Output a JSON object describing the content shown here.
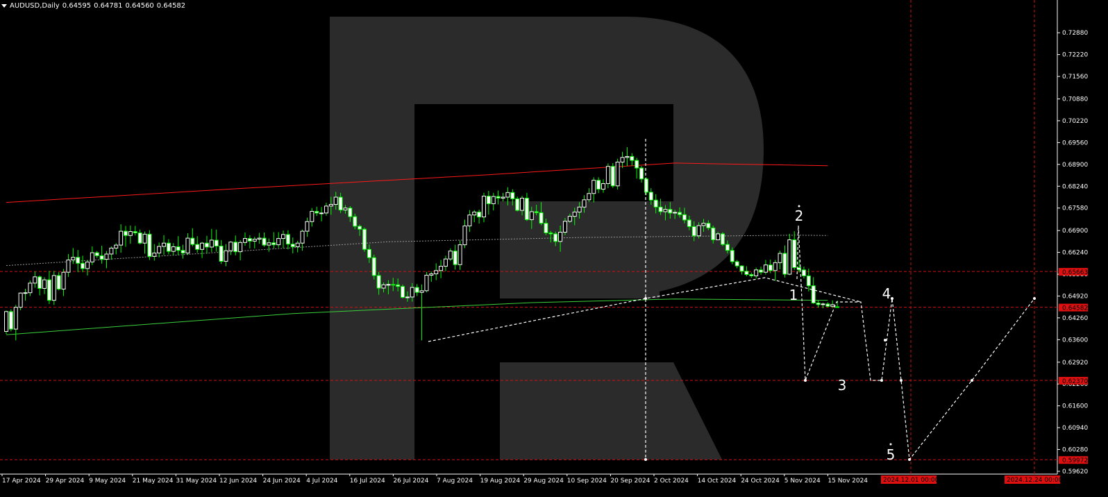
{
  "header": {
    "symbol": "AUDUSD,Daily",
    "open": "0.64595",
    "high": "0.64781",
    "low": "0.64560",
    "close": "0.64582"
  },
  "colors": {
    "background": "#000000",
    "bull_candle": "#ffffff",
    "bear_candle": "#ffffff",
    "wick": "#00ff00",
    "ma_slow": "#ff1a1a",
    "ma_long": "#3bd33b",
    "level_line": "#d01010",
    "projection": "#ffffff",
    "price_box": "#e01010",
    "axis_text": "#ffffff"
  },
  "chart_data": {
    "type": "candlestick",
    "symbol": "AUDUSD",
    "timeframe": "Daily",
    "ylim": [
      0.5962,
      0.7322
    ],
    "y_ticks": [
      "0.72880",
      "0.72220",
      "0.71560",
      "0.70880",
      "0.70220",
      "0.69560",
      "0.68900",
      "0.68240",
      "0.67580",
      "0.66900",
      "0.66240",
      "0.65580",
      "0.64920",
      "0.64260",
      "0.63600",
      "0.62920",
      "0.62260",
      "0.61600",
      "0.60940",
      "0.60280",
      "0.59620"
    ],
    "x_ticks": [
      "17 Apr 2024",
      "29 Apr 2024",
      "9 May 2024",
      "21 May 2024",
      "31 May 2024",
      "12 Jun 2024",
      "24 Jun 2024",
      "4 Jul 2024",
      "16 Jul 2024",
      "26 Jul 2024",
      "7 Aug 2024",
      "19 Aug 2024",
      "29 Aug 2024",
      "10 Sep 2024",
      "20 Sep 2024",
      "2 Oct 2024",
      "14 Oct 2024",
      "24 Oct 2024",
      "5 Nov 2024",
      "15 Nov 2024"
    ],
    "x_tick_dates": [
      "2024-04-17",
      "2024-04-29",
      "2024-05-09",
      "2024-05-21",
      "2024-05-31",
      "2024-06-12",
      "2024-06-24",
      "2024-07-04",
      "2024-07-16",
      "2024-07-26",
      "2024-08-07",
      "2024-08-19",
      "2024-08-29",
      "2024-09-10",
      "2024-09-20",
      "2024-10-02",
      "2024-10-14",
      "2024-10-24",
      "2024-11-05",
      "2024-11-15"
    ],
    "future_date_labels": [
      "2024.12.01 00:00",
      "2024.12.24 00:00"
    ],
    "price_levels": [
      {
        "label": "0.65663",
        "value": 0.65663
      },
      {
        "label": "0.64582",
        "value": 0.64582
      },
      {
        "label": "0.62370",
        "value": 0.6237
      },
      {
        "label": "0.59972",
        "value": 0.59972
      }
    ],
    "wave_labels": [
      "1",
      "2",
      "3",
      "4",
      "5"
    ],
    "candles_ohlc": [
      [
        0.6385,
        0.6448,
        0.6377,
        0.6445
      ],
      [
        0.6445,
        0.6452,
        0.6385,
        0.6392
      ],
      [
        0.6392,
        0.6465,
        0.6358,
        0.6458
      ],
      [
        0.6458,
        0.6503,
        0.6449,
        0.6501
      ],
      [
        0.6501,
        0.6514,
        0.6478,
        0.6502
      ],
      [
        0.6502,
        0.6539,
        0.6492,
        0.6531
      ],
      [
        0.6531,
        0.6566,
        0.6517,
        0.655
      ],
      [
        0.655,
        0.6554,
        0.6494,
        0.6515
      ],
      [
        0.6515,
        0.6549,
        0.6498,
        0.6541
      ],
      [
        0.6541,
        0.6568,
        0.6468,
        0.6479
      ],
      [
        0.6479,
        0.6568,
        0.6465,
        0.6554
      ],
      [
        0.6554,
        0.6564,
        0.6509,
        0.6513
      ],
      [
        0.6513,
        0.6574,
        0.6492,
        0.6564
      ],
      [
        0.6564,
        0.6619,
        0.655,
        0.6601
      ],
      [
        0.6601,
        0.6637,
        0.6589,
        0.6609
      ],
      [
        0.6609,
        0.6631,
        0.6564,
        0.6591
      ],
      [
        0.6591,
        0.6614,
        0.6564,
        0.6575
      ],
      [
        0.6575,
        0.6601,
        0.6554,
        0.6595
      ],
      [
        0.6595,
        0.6642,
        0.6586,
        0.6623
      ],
      [
        0.6623,
        0.6628,
        0.6607,
        0.6614
      ],
      [
        0.6614,
        0.6644,
        0.659,
        0.6603
      ],
      [
        0.6603,
        0.6628,
        0.6576,
        0.6619
      ],
      [
        0.6619,
        0.6642,
        0.6602,
        0.6637
      ],
      [
        0.6637,
        0.6652,
        0.6618,
        0.6646
      ],
      [
        0.6646,
        0.6709,
        0.6623,
        0.6688
      ],
      [
        0.6688,
        0.6704,
        0.6641,
        0.6675
      ],
      [
        0.6675,
        0.6705,
        0.665,
        0.6687
      ],
      [
        0.6687,
        0.6704,
        0.6675,
        0.6683
      ],
      [
        0.6683,
        0.6693,
        0.6648,
        0.6652
      ],
      [
        0.6652,
        0.6687,
        0.662,
        0.6679
      ],
      [
        0.6679,
        0.6691,
        0.6601,
        0.6612
      ],
      [
        0.6612,
        0.6649,
        0.6599,
        0.6622
      ],
      [
        0.6622,
        0.6654,
        0.6609,
        0.6642
      ],
      [
        0.6642,
        0.6676,
        0.6616,
        0.6652
      ],
      [
        0.6652,
        0.6664,
        0.6618,
        0.6627
      ],
      [
        0.6627,
        0.6652,
        0.6615,
        0.6641
      ],
      [
        0.6641,
        0.6673,
        0.6616,
        0.663
      ],
      [
        0.663,
        0.6647,
        0.6605,
        0.6622
      ],
      [
        0.6622,
        0.6682,
        0.6616,
        0.6667
      ],
      [
        0.6667,
        0.6697,
        0.6642,
        0.6648
      ],
      [
        0.6648,
        0.6673,
        0.6623,
        0.6633
      ],
      [
        0.6633,
        0.6656,
        0.6607,
        0.6652
      ],
      [
        0.6652,
        0.6674,
        0.662,
        0.664
      ],
      [
        0.664,
        0.6695,
        0.6625,
        0.6661
      ],
      [
        0.6661,
        0.6693,
        0.6626,
        0.6643
      ],
      [
        0.6643,
        0.6661,
        0.6589,
        0.6597
      ],
      [
        0.6597,
        0.6649,
        0.6582,
        0.6629
      ],
      [
        0.6629,
        0.6658,
        0.6616,
        0.6655
      ],
      [
        0.6655,
        0.6675,
        0.6615,
        0.6626
      ],
      [
        0.6626,
        0.6661,
        0.66,
        0.6654
      ],
      [
        0.6654,
        0.6684,
        0.6644,
        0.6666
      ],
      [
        0.6666,
        0.6676,
        0.6636,
        0.6658
      ],
      [
        0.6658,
        0.6671,
        0.6636,
        0.6664
      ],
      [
        0.6664,
        0.6683,
        0.665,
        0.6667
      ],
      [
        0.6667,
        0.6684,
        0.6641,
        0.6646
      ],
      [
        0.6646,
        0.6666,
        0.6626,
        0.6653
      ],
      [
        0.6653,
        0.6685,
        0.6636,
        0.6647
      ],
      [
        0.6647,
        0.6685,
        0.6638,
        0.6666
      ],
      [
        0.6666,
        0.669,
        0.6637,
        0.6678
      ],
      [
        0.6678,
        0.6691,
        0.6633,
        0.6649
      ],
      [
        0.6649,
        0.6669,
        0.6621,
        0.6641
      ],
      [
        0.6641,
        0.6659,
        0.6624,
        0.6652
      ],
      [
        0.6652,
        0.6693,
        0.6629,
        0.6688
      ],
      [
        0.6688,
        0.6729,
        0.6671,
        0.6717
      ],
      [
        0.6717,
        0.6758,
        0.6702,
        0.6748
      ],
      [
        0.6748,
        0.6762,
        0.6734,
        0.6743
      ],
      [
        0.6743,
        0.6761,
        0.6718,
        0.6743
      ],
      [
        0.6743,
        0.6774,
        0.6735,
        0.6764
      ],
      [
        0.6764,
        0.6792,
        0.6738,
        0.6769
      ],
      [
        0.6769,
        0.6807,
        0.6753,
        0.6791
      ],
      [
        0.6791,
        0.6804,
        0.6743,
        0.6752
      ],
      [
        0.6752,
        0.6767,
        0.6741,
        0.6758
      ],
      [
        0.6758,
        0.6764,
        0.6716,
        0.6732
      ],
      [
        0.6732,
        0.6741,
        0.6694,
        0.6703
      ],
      [
        0.6703,
        0.6708,
        0.6674,
        0.6694
      ],
      [
        0.6694,
        0.6699,
        0.6626,
        0.6633
      ],
      [
        0.6633,
        0.6648,
        0.6592,
        0.6608
      ],
      [
        0.6608,
        0.6617,
        0.6542,
        0.6554
      ],
      [
        0.6554,
        0.6565,
        0.6496,
        0.6516
      ],
      [
        0.6516,
        0.6533,
        0.6503,
        0.6526
      ],
      [
        0.6526,
        0.654,
        0.6497,
        0.6527
      ],
      [
        0.6527,
        0.6547,
        0.6507,
        0.6526
      ],
      [
        0.6526,
        0.6545,
        0.6506,
        0.6521
      ],
      [
        0.6521,
        0.6527,
        0.6485,
        0.6488
      ],
      [
        0.6488,
        0.6506,
        0.6475,
        0.6489
      ],
      [
        0.6489,
        0.6531,
        0.6475,
        0.6518
      ],
      [
        0.6518,
        0.6528,
        0.6492,
        0.6503
      ],
      [
        0.6503,
        0.6527,
        0.6358,
        0.6508
      ],
      [
        0.6508,
        0.6565,
        0.6503,
        0.6555
      ],
      [
        0.6555,
        0.6566,
        0.6535,
        0.6559
      ],
      [
        0.6559,
        0.6591,
        0.654,
        0.6569
      ],
      [
        0.6569,
        0.6601,
        0.6546,
        0.6582
      ],
      [
        0.6582,
        0.6614,
        0.6567,
        0.6604
      ],
      [
        0.6604,
        0.6636,
        0.6598,
        0.6628
      ],
      [
        0.6628,
        0.6647,
        0.6572,
        0.6587
      ],
      [
        0.6587,
        0.666,
        0.6571,
        0.6647
      ],
      [
        0.6647,
        0.6723,
        0.6637,
        0.6704
      ],
      [
        0.6704,
        0.6752,
        0.6686,
        0.6737
      ],
      [
        0.6737,
        0.6752,
        0.6715,
        0.6746
      ],
      [
        0.6746,
        0.6753,
        0.6711,
        0.6731
      ],
      [
        0.6731,
        0.6804,
        0.6715,
        0.6794
      ],
      [
        0.6794,
        0.681,
        0.6738,
        0.6771
      ],
      [
        0.6771,
        0.6804,
        0.6751,
        0.6793
      ],
      [
        0.6793,
        0.6811,
        0.6769,
        0.6788
      ],
      [
        0.6788,
        0.6804,
        0.6778,
        0.6791
      ],
      [
        0.6791,
        0.6821,
        0.6766,
        0.6805
      ],
      [
        0.6805,
        0.6815,
        0.6766,
        0.6786
      ],
      [
        0.6786,
        0.6793,
        0.6748,
        0.6751
      ],
      [
        0.6751,
        0.6795,
        0.6736,
        0.6788
      ],
      [
        0.6788,
        0.6804,
        0.6719,
        0.6723
      ],
      [
        0.6723,
        0.6762,
        0.6695,
        0.6747
      ],
      [
        0.6747,
        0.6768,
        0.6736,
        0.6744
      ],
      [
        0.6744,
        0.6776,
        0.6706,
        0.6712
      ],
      [
        0.6712,
        0.6726,
        0.6676,
        0.6683
      ],
      [
        0.6683,
        0.6689,
        0.6654,
        0.668
      ],
      [
        0.668,
        0.6687,
        0.6643,
        0.6657
      ],
      [
        0.6657,
        0.6705,
        0.6626,
        0.6685
      ],
      [
        0.6685,
        0.6728,
        0.6676,
        0.6718
      ],
      [
        0.6718,
        0.6741,
        0.6713,
        0.6733
      ],
      [
        0.6733,
        0.6759,
        0.6706,
        0.6746
      ],
      [
        0.6746,
        0.6776,
        0.6726,
        0.6761
      ],
      [
        0.6761,
        0.6797,
        0.6744,
        0.6783
      ],
      [
        0.6783,
        0.6818,
        0.6776,
        0.6802
      ],
      [
        0.6802,
        0.6851,
        0.6775,
        0.6842
      ],
      [
        0.6842,
        0.6851,
        0.6803,
        0.6815
      ],
      [
        0.6815,
        0.6845,
        0.6804,
        0.6832
      ],
      [
        0.6832,
        0.6893,
        0.6818,
        0.6884
      ],
      [
        0.6884,
        0.6894,
        0.6819,
        0.6825
      ],
      [
        0.6825,
        0.6907,
        0.6814,
        0.6897
      ],
      [
        0.6897,
        0.6928,
        0.6879,
        0.6911
      ],
      [
        0.6911,
        0.6942,
        0.6885,
        0.6914
      ],
      [
        0.6914,
        0.6924,
        0.6886,
        0.6902
      ],
      [
        0.6902,
        0.691,
        0.6847,
        0.6879
      ],
      [
        0.6879,
        0.6885,
        0.6835,
        0.6846
      ],
      [
        0.6846,
        0.6851,
        0.6797,
        0.6806
      ],
      [
        0.6806,
        0.6818,
        0.6768,
        0.6782
      ],
      [
        0.6782,
        0.68,
        0.6742,
        0.6761
      ],
      [
        0.6761,
        0.6786,
        0.6737,
        0.6747
      ],
      [
        0.6747,
        0.6767,
        0.6721,
        0.6754
      ],
      [
        0.6754,
        0.6776,
        0.6726,
        0.6743
      ],
      [
        0.6743,
        0.6753,
        0.6725,
        0.6745
      ],
      [
        0.6745,
        0.676,
        0.6729,
        0.6738
      ],
      [
        0.6738,
        0.6759,
        0.6712,
        0.6722
      ],
      [
        0.6722,
        0.6735,
        0.6691,
        0.6702
      ],
      [
        0.6702,
        0.6718,
        0.6658,
        0.6674
      ],
      [
        0.6674,
        0.6715,
        0.6666,
        0.6705
      ],
      [
        0.6705,
        0.6725,
        0.6686,
        0.6712
      ],
      [
        0.6712,
        0.6721,
        0.6691,
        0.6698
      ],
      [
        0.6698,
        0.6705,
        0.6651,
        0.6662
      ],
      [
        0.6662,
        0.6686,
        0.6661,
        0.668
      ],
      [
        0.668,
        0.6685,
        0.6643,
        0.6648
      ],
      [
        0.6648,
        0.666,
        0.6621,
        0.663
      ],
      [
        0.663,
        0.6639,
        0.6588,
        0.6596
      ],
      [
        0.6596,
        0.6601,
        0.6576,
        0.6583
      ],
      [
        0.6583,
        0.6585,
        0.6557,
        0.6567
      ],
      [
        0.6567,
        0.6582,
        0.6552,
        0.6557
      ],
      [
        0.6557,
        0.6563,
        0.6547,
        0.6553
      ],
      [
        0.6553,
        0.6578,
        0.6545,
        0.6571
      ],
      [
        0.6571,
        0.6581,
        0.6556,
        0.6564
      ],
      [
        0.6564,
        0.6601,
        0.6557,
        0.6586
      ],
      [
        0.6586,
        0.6602,
        0.6561,
        0.6569
      ],
      [
        0.6569,
        0.6601,
        0.6538,
        0.6593
      ],
      [
        0.6593,
        0.6629,
        0.6573,
        0.6621
      ],
      [
        0.6621,
        0.6645,
        0.6548,
        0.6558
      ],
      [
        0.6558,
        0.668,
        0.6555,
        0.6662
      ],
      [
        0.6662,
        0.6688,
        0.6571,
        0.6578
      ],
      [
        0.6578,
        0.6601,
        0.6563,
        0.6571
      ],
      [
        0.6571,
        0.6581,
        0.6545,
        0.6553
      ],
      [
        0.6553,
        0.6575,
        0.6506,
        0.6523
      ],
      [
        0.6523,
        0.6549,
        0.6468,
        0.6471
      ],
      [
        0.6471,
        0.6478,
        0.6457,
        0.6466
      ],
      [
        0.6466,
        0.6472,
        0.6455,
        0.6468
      ],
      [
        0.6468,
        0.6473,
        0.6458,
        0.6461
      ],
      [
        0.6461,
        0.6479,
        0.6456,
        0.6466
      ],
      [
        0.64595,
        0.64781,
        0.6456,
        0.64582
      ]
    ],
    "moving_averages": [
      {
        "color": "red",
        "points": [
          [
            0,
            0.6775
          ],
          [
            50,
            0.6818
          ],
          [
            100,
            0.6858
          ],
          [
            140,
            0.6894
          ],
          [
            172,
            0.6886
          ]
        ]
      },
      {
        "color": "grey-dotted",
        "points": [
          [
            0,
            0.6584
          ],
          [
            40,
            0.662
          ],
          [
            80,
            0.6656
          ],
          [
            120,
            0.6669
          ],
          [
            165,
            0.6676
          ],
          [
            172,
            0.6675
          ]
        ]
      },
      {
        "color": "green",
        "points": [
          [
            0,
            0.6375
          ],
          [
            60,
            0.6439
          ],
          [
            110,
            0.6472
          ],
          [
            140,
            0.6483
          ],
          [
            172,
            0.6479
          ]
        ]
      }
    ],
    "projection_path": [
      "0.64582",
      "0.62370",
      "0.64700",
      "0.59972",
      "0.64700"
    ]
  }
}
